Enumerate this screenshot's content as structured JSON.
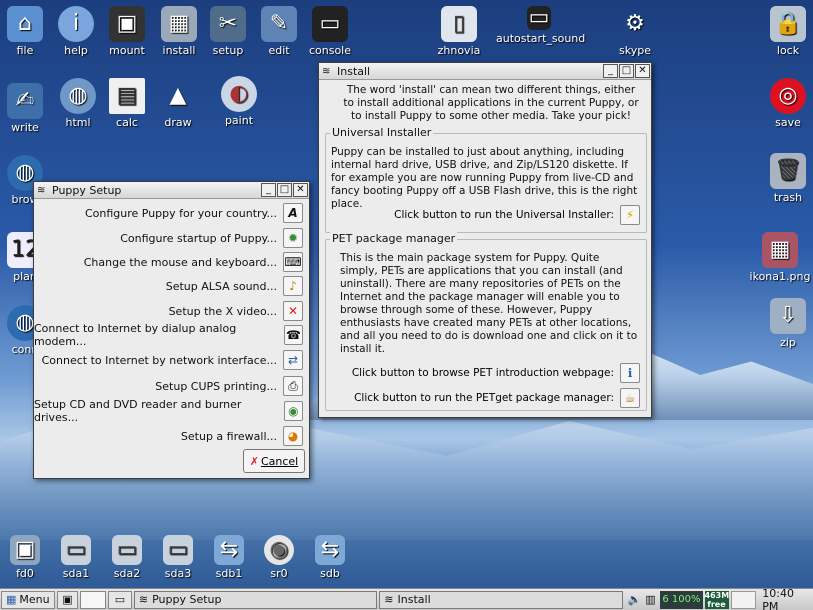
{
  "desktop": {
    "icons": [
      {
        "label": "file",
        "icon": "home-folder-icon"
      },
      {
        "label": "help",
        "icon": "info-icon"
      },
      {
        "label": "mount",
        "icon": "monitor-icon"
      },
      {
        "label": "install",
        "icon": "package-box-icon"
      },
      {
        "label": "setup",
        "icon": "tools-icon"
      },
      {
        "label": "edit",
        "icon": "pen-icon"
      },
      {
        "label": "console",
        "icon": "terminal-icon"
      },
      {
        "label": "zhnovia",
        "icon": "document-icon"
      },
      {
        "label": "autostart_sound",
        "icon": "terminal-icon"
      },
      {
        "label": "skype",
        "icon": "gear-icon"
      },
      {
        "label": "lock",
        "icon": "padlock-icon"
      },
      {
        "label": "write",
        "icon": "writer-icon"
      },
      {
        "label": "html",
        "icon": "globe-icon"
      },
      {
        "label": "calc",
        "icon": "spreadsheet-icon"
      },
      {
        "label": "draw",
        "icon": "shapes-icon"
      },
      {
        "label": "paint",
        "icon": "palette-icon"
      },
      {
        "label": "save",
        "icon": "save-target-icon"
      },
      {
        "label": "brow",
        "icon": "browser-icon"
      },
      {
        "label": "trash",
        "icon": "trash-icon"
      },
      {
        "label": "plan",
        "icon": "calendar-icon"
      },
      {
        "label": "ikona1.png",
        "icon": "image-icon"
      },
      {
        "label": "conn",
        "icon": "network-icon"
      },
      {
        "label": "zip",
        "icon": "zip-icon"
      },
      {
        "label": "fd0",
        "icon": "floppy-icon"
      },
      {
        "label": "sda1",
        "icon": "drive-icon"
      },
      {
        "label": "sda2",
        "icon": "drive-icon"
      },
      {
        "label": "sda3",
        "icon": "drive-icon"
      },
      {
        "label": "sdb1",
        "icon": "usb-icon"
      },
      {
        "label": "sr0",
        "icon": "cd-icon"
      },
      {
        "label": "sdb",
        "icon": "usb-icon"
      }
    ]
  },
  "setup_window": {
    "title": "Puppy Setup",
    "rows": [
      {
        "label": "Configure Puppy for your country...",
        "icon": "A"
      },
      {
        "label": "Configure startup of Puppy...",
        "icon": "✹"
      },
      {
        "label": "Change the mouse and keyboard...",
        "icon": "⌨"
      },
      {
        "label": "Setup ALSA sound...",
        "icon": "♪"
      },
      {
        "label": "Setup the X video...",
        "icon": "✕"
      },
      {
        "label": "Connect to Internet by dialup analog modem...",
        "icon": "☎"
      },
      {
        "label": "Connect to Internet by network interface...",
        "icon": "⇄"
      },
      {
        "label": "Setup CUPS printing...",
        "icon": "⎙"
      },
      {
        "label": "Setup CD and DVD reader and burner drives...",
        "icon": "◉"
      },
      {
        "label": "Setup a firewall...",
        "icon": "◕"
      }
    ],
    "cancel_label": "Cancel"
  },
  "install_window": {
    "title": "Install",
    "intro": "The word 'install' can mean two different things, either to install additional applications in the current Puppy, or to install Puppy to some other media. Take your pick!",
    "universal": {
      "heading": "Universal Installer",
      "text": "Puppy can be installed to just about anything, including internal hard drive, USB drive, and Zip/LS120 diskette. If for example you are now running Puppy from live-CD and fancy booting Puppy off a USB Flash drive, this is the right place.",
      "button_label": "Click button to run the Universal Installer:"
    },
    "pet": {
      "heading": "PET package manager",
      "text": "This is the main package system for Puppy. Quite simply, PETs are applications that you can install (and uninstall). There are many repositories of PETs on the Internet and the package manager will enable you to browse through some of these. However, Puppy enthusiasts have created many PETs at other locations, and all you need to do is download one and click on it to install it.",
      "browse_label": "Click button to browse PET introduction webpage:",
      "run_label": "Click button to run the PETget package manager:"
    }
  },
  "taskbar": {
    "menu_label": "Menu",
    "tasks": [
      "Puppy Setup",
      "Install"
    ],
    "cpu": "6",
    "mem": "100%",
    "free_top": "463M",
    "free_bottom": "free",
    "clock": "10:40 PM"
  }
}
